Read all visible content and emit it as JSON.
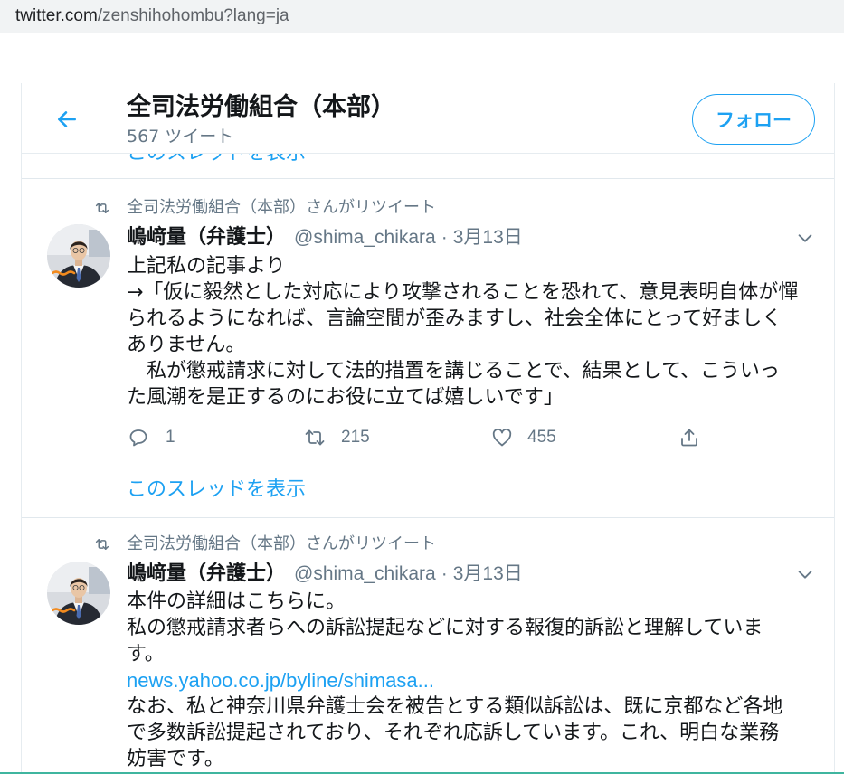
{
  "browser": {
    "url_domain": "twitter.com",
    "url_path": "/zenshihohombu?lang=ja"
  },
  "header": {
    "title": "全司法労働組合（本部）",
    "tweet_count": "567 ツイート",
    "follow_label": "フォロー"
  },
  "prev_thread_link": "このスレッドを表示",
  "tweets": [
    {
      "retweet_context": "全司法労働組合（本部）さんがリツイート",
      "name": "嶋﨑量（弁護士）",
      "handle": "@shima_chikara",
      "separator": "·",
      "date": "3月13日",
      "lines": [
        "上記私の記事より",
        "→「仮に毅然とした対応により攻撃されることを恐れて、意見表明自体が憚",
        "られるようになれば、言論空間が歪みますし、社会全体にとって好ましく",
        "ありません。",
        "　私が懲戒請求に対して法的措置を講じることで、結果として、こういっ",
        "た風潮を是正するのにお役に立てば嬉しいです」"
      ],
      "reply_count": "1",
      "retweet_count": "215",
      "like_count": "455",
      "show_thread_label": "このスレッドを表示"
    },
    {
      "retweet_context": "全司法労働組合（本部）さんがリツイート",
      "name": "嶋﨑量（弁護士）",
      "handle": "@shima_chikara",
      "separator": "·",
      "date": "3月13日",
      "lines_before_link": [
        "本件の詳細はこちらに。",
        "私の懲戒請求者らへの訴訟提起などに対する報復的訴訟と理解していま",
        "す。"
      ],
      "link": "news.yahoo.co.jp/byline/shimasa...",
      "lines_after_link": [
        "なお、私と神奈川県弁護士会を被告とする類似訴訟は、既に京都など各地",
        "で多数訴訟提起されており、それぞれ応訴しています。これ、明白な業務",
        "妨害です。"
      ]
    }
  ],
  "icons": {
    "back": "arrow-left-icon",
    "retweet_context": "retweet-icon",
    "more": "chevron-down-icon",
    "reply": "reply-icon",
    "retweet": "retweet-icon",
    "like": "heart-icon",
    "share": "share-icon"
  },
  "colors": {
    "accent": "#1da1f2",
    "text": "#14171a",
    "secondary": "#657786",
    "border": "#e6ecf0",
    "url_bar": "#f1f3f4"
  }
}
